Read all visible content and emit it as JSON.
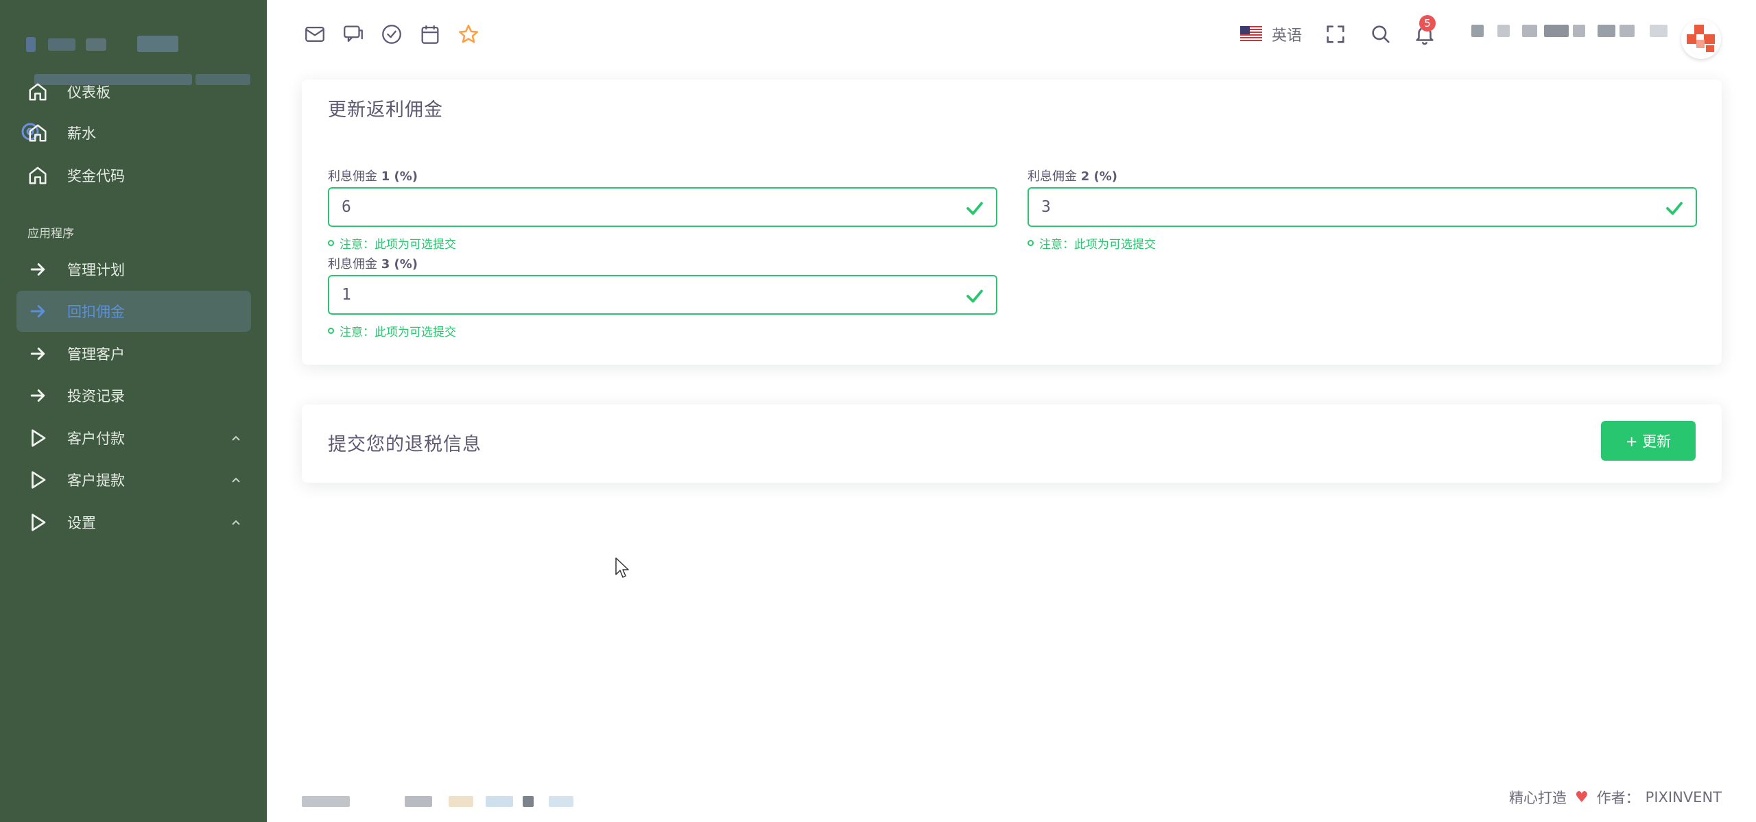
{
  "sidebar": {
    "items_top": [
      {
        "label": "仪表板",
        "icon": "home-icon"
      },
      {
        "label": "薪水",
        "icon": "home-icon"
      },
      {
        "label": "奖金代码",
        "icon": "home-icon"
      }
    ],
    "section_label": "应用程序",
    "items_app": [
      {
        "label": "管理计划",
        "icon": "arrow-right-icon"
      },
      {
        "label": "回扣佣金",
        "icon": "arrow-right-icon"
      },
      {
        "label": "管理客户",
        "icon": "arrow-right-icon"
      },
      {
        "label": "投资记录",
        "icon": "arrow-right-icon"
      },
      {
        "label": "客户付款",
        "icon": "play-icon"
      },
      {
        "label": "客户提款",
        "icon": "play-icon"
      },
      {
        "label": "设置",
        "icon": "play-icon"
      }
    ]
  },
  "topbar": {
    "language": "英语",
    "notification_count": "5"
  },
  "rebate_card": {
    "title": "更新返利佣金",
    "fields": [
      {
        "label_prefix": "利息佣金",
        "label_suffix": "1 (%)",
        "value": "6",
        "note": "注意：此项为可选提交"
      },
      {
        "label_prefix": "利息佣金",
        "label_suffix": "2 (%)",
        "value": "3",
        "note": "注意：此项为可选提交"
      },
      {
        "label_prefix": "利息佣金",
        "label_suffix": "3 (%)",
        "value": "1",
        "note": "注意：此项为可选提交"
      }
    ]
  },
  "tax_card": {
    "title": "提交您的退税信息",
    "button_label": "+ 更新"
  },
  "footer": {
    "made_with": "精心打造",
    "author_label": "作者：",
    "author": "PIXINVENT"
  },
  "colors": {
    "sidebar_bg": "#3f5a40",
    "active_text": "#5b8fd8",
    "success": "#28c76f",
    "danger": "#ea5455",
    "star": "#ff9f43"
  }
}
